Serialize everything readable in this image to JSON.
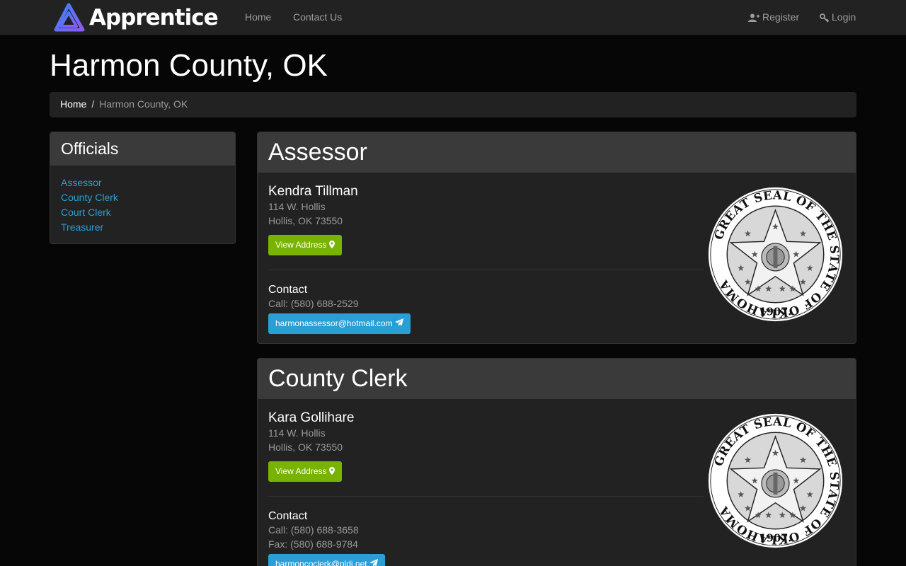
{
  "nav": {
    "brand": "Apprentice",
    "home": "Home",
    "contact": "Contact Us",
    "register": "Register",
    "login": "Login"
  },
  "page": {
    "title": "Harmon County, OK"
  },
  "breadcrumb": {
    "home": "Home",
    "separator": "/",
    "current": "Harmon County, OK"
  },
  "sidebar": {
    "title": "Officials",
    "items": [
      {
        "label": "Assessor"
      },
      {
        "label": "County Clerk"
      },
      {
        "label": "Court Clerk"
      },
      {
        "label": "Treasurer"
      }
    ]
  },
  "seal": {
    "text_top": "GREAT SEAL OF THE STATE OF OKLAHOMA",
    "year": "1907."
  },
  "panels": [
    {
      "title": "Assessor",
      "name": "Kendra Tillman",
      "address_line1": "114 W. Hollis",
      "address_line2": "Hollis, OK 73550",
      "view_address": "View Address",
      "contact_label": "Contact",
      "call": "Call: (580) 688-2529",
      "email": "harmonassessor@hotmail.com"
    },
    {
      "title": "County Clerk",
      "name": "Kara Gollihare",
      "address_line1": "114 W. Hollis",
      "address_line2": "Hollis, OK 73550",
      "view_address": "View Address",
      "contact_label": "Contact",
      "call": "Call: (580) 688-3658",
      "fax": "Fax: (580) 688-9784",
      "email": "harmoncoclerk@pldi.net"
    }
  ],
  "colors": {
    "accent_link": "#2a9fd6",
    "button_green": "#77b300",
    "button_blue": "#2a9fd6",
    "logo_gradient_start": "#3b82f6",
    "logo_gradient_end": "#8b5cf6"
  }
}
